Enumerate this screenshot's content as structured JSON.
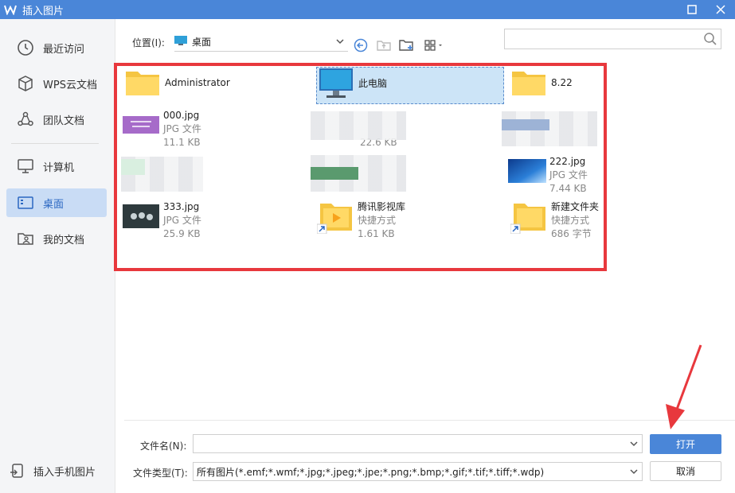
{
  "window": {
    "title": "插入图片"
  },
  "sidebar": {
    "items": [
      {
        "label": "最近访问",
        "icon": "clock-icon"
      },
      {
        "label": "WPS云文档",
        "icon": "cube-icon"
      },
      {
        "label": "团队文档",
        "icon": "team-icon"
      },
      {
        "label": "计算机",
        "icon": "monitor-icon"
      },
      {
        "label": "桌面",
        "icon": "desktop-icon"
      },
      {
        "label": "我的文档",
        "icon": "my-docs-icon"
      }
    ],
    "bottom_item": {
      "label": "插入手机图片",
      "icon": "phone-import-icon"
    }
  },
  "toolbar": {
    "location_label": "位置(I):",
    "location_value": "桌面",
    "search_placeholder": ""
  },
  "files": [
    {
      "name": "Administrator",
      "type": "",
      "size": "",
      "kind": "folder"
    },
    {
      "name": "此电脑",
      "type": "",
      "size": "",
      "kind": "pc",
      "selected": true
    },
    {
      "name": "8.22",
      "type": "",
      "size": "",
      "kind": "folder"
    },
    {
      "name": "000.jpg",
      "type": "JPG 文件",
      "size": "11.1 KB",
      "kind": "image-purple"
    },
    {
      "name": "",
      "type": "",
      "size": "22.6 KB",
      "kind": "blurred"
    },
    {
      "name": "",
      "type": "",
      "size": "",
      "kind": "blurred"
    },
    {
      "name": "",
      "type": "",
      "size": "",
      "kind": "blurred"
    },
    {
      "name": "",
      "type": "",
      "size": "",
      "kind": "blurred"
    },
    {
      "name": "222.jpg",
      "type": "JPG 文件",
      "size": "7.44 KB",
      "kind": "image-blue"
    },
    {
      "name": "333.jpg",
      "type": "JPG 文件",
      "size": "25.9 KB",
      "kind": "image-dark"
    },
    {
      "name": "腾讯影视库",
      "type": "快捷方式",
      "size": "1.61 KB",
      "kind": "shortcut-video"
    },
    {
      "name": "新建文件夹",
      "type": "快捷方式",
      "size": "686 字节",
      "kind": "shortcut-folder"
    }
  ],
  "bottom": {
    "filename_label": "文件名(N):",
    "filename_value": "",
    "filetype_label": "文件类型(T):",
    "filetype_value": "所有图片(*.emf;*.wmf;*.jpg;*.jpeg;*.jpe;*.png;*.bmp;*.gif;*.tif;*.tiff;*.wdp)",
    "open_label": "打开",
    "cancel_label": "取消"
  },
  "colors": {
    "accent": "#4a86d8",
    "highlight": "#e8383d",
    "arrow": "#e8383d"
  }
}
